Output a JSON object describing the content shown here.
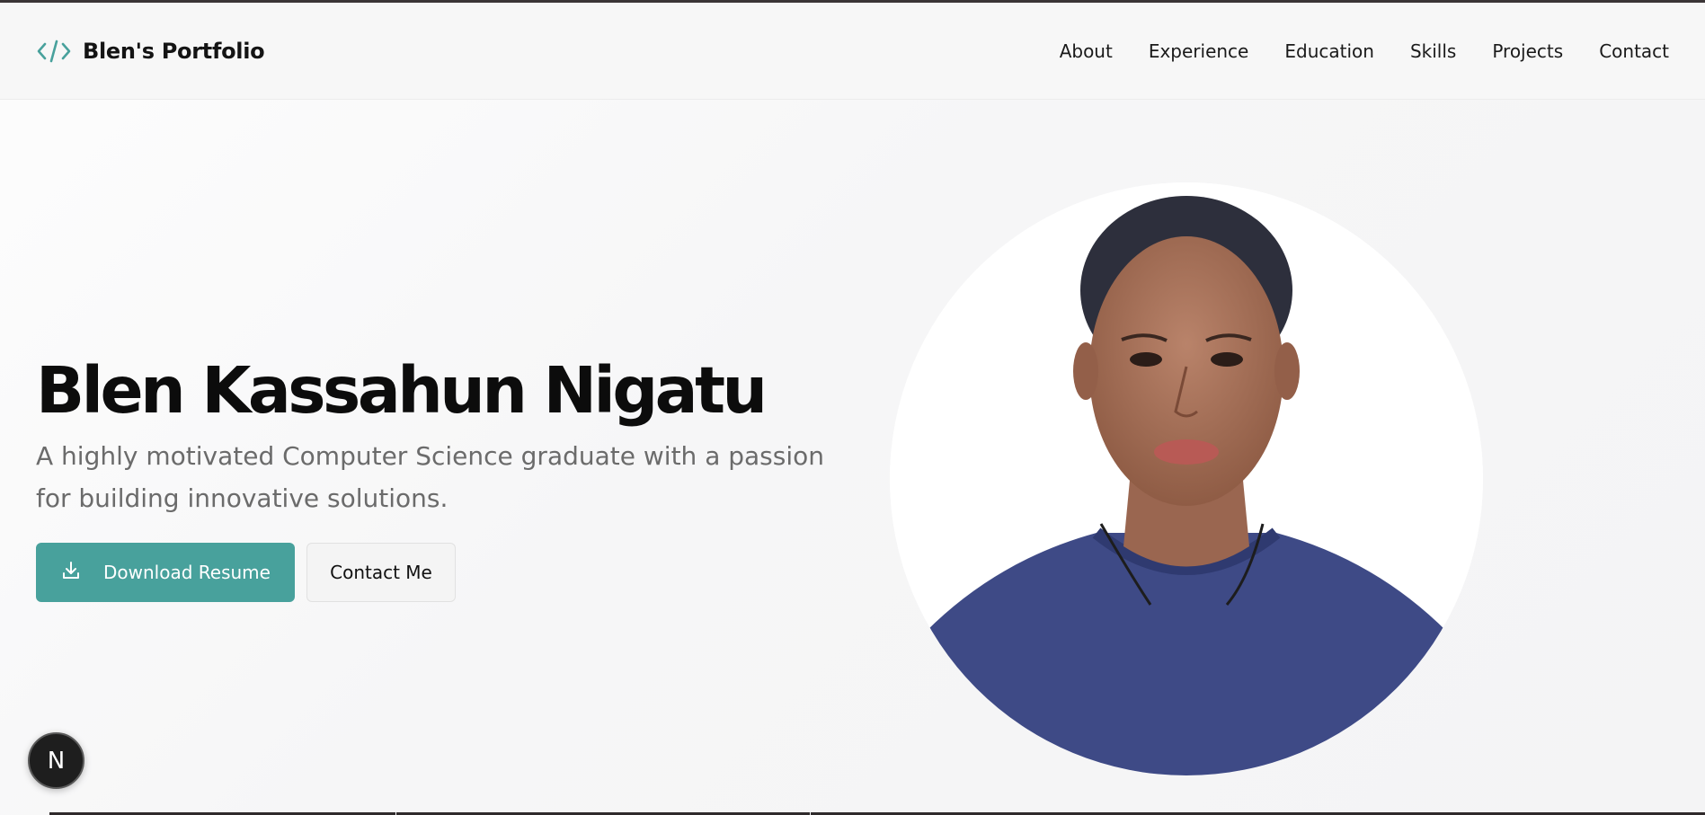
{
  "header": {
    "brand_name": "Blen's Portfolio",
    "brand_icon": "code-icon",
    "nav": [
      "About",
      "Experience",
      "Education",
      "Skills",
      "Projects",
      "Contact"
    ]
  },
  "hero": {
    "name": "Blen Kassahun Nigatu",
    "tagline": "A highly motivated Computer Science graduate with a passion for building innovative solutions.",
    "download_label": "Download Resume",
    "download_icon": "download-icon",
    "contact_label": "Contact Me",
    "portrait": "profile-photo"
  },
  "overlay": {
    "badge_letter": "N"
  },
  "colors": {
    "accent": "#48a19c",
    "text": "#0c0c0c",
    "muted": "#6b6b6b"
  }
}
